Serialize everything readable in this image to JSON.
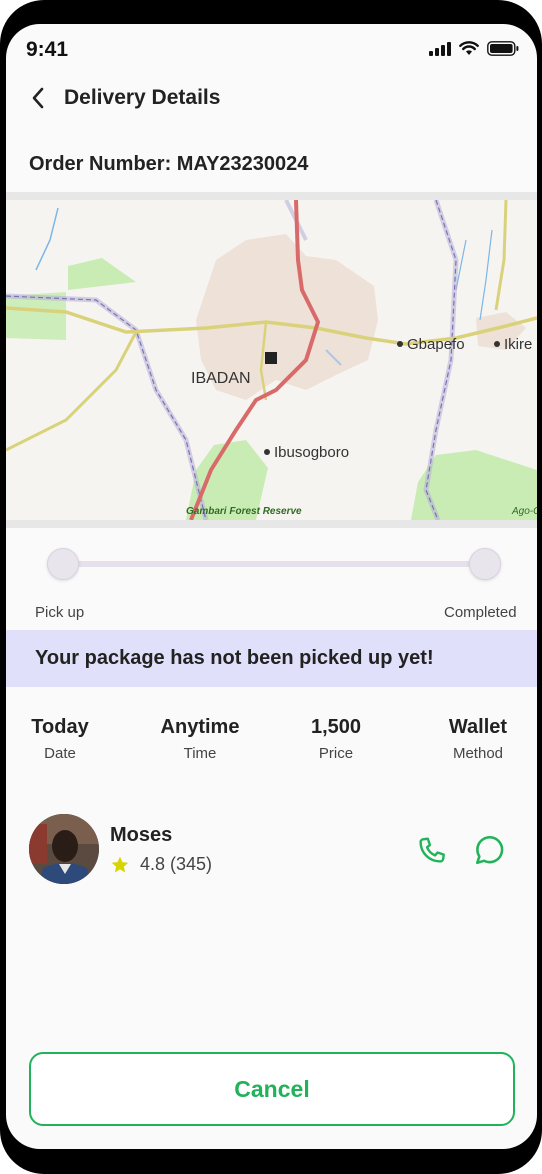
{
  "status_bar": {
    "time": "9:41"
  },
  "header": {
    "title": "Delivery Details"
  },
  "order": {
    "label": "Order Number: MAY23230024"
  },
  "map": {
    "city": "IBADAN",
    "places": [
      "Gbapefo",
      "Ikire",
      "Ibusogboro"
    ],
    "reserve": "Gambari Forest Reserve",
    "edge_label": "Ago-O"
  },
  "progress": {
    "start_label": "Pick up",
    "end_label": "Completed",
    "fraction": 0
  },
  "notice": {
    "text": "Your package has not been picked up yet!"
  },
  "details": [
    {
      "value": "Today",
      "label": "Date"
    },
    {
      "value": "Anytime",
      "label": "Time"
    },
    {
      "value": "1,500",
      "label": "Price"
    },
    {
      "value": "Wallet",
      "label": "Method"
    }
  ],
  "driver": {
    "name": "Moses",
    "rating": "4.8 (345)"
  },
  "colors": {
    "accent": "#22b35a",
    "notice_bg": "#e1e0fb",
    "star": "#d8d400"
  },
  "actions": {
    "cancel_label": "Cancel"
  }
}
